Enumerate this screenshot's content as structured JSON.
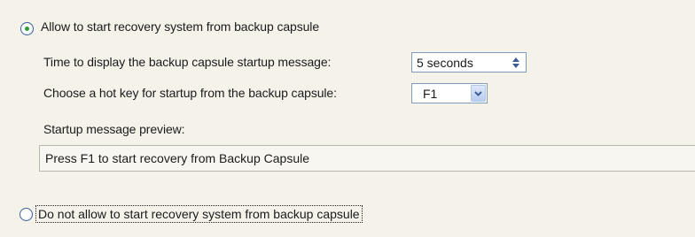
{
  "options": {
    "allow": {
      "label": "Allow to start recovery system from backup capsule",
      "selected": true
    },
    "deny": {
      "label": "Do not allow to start recovery system from backup capsule",
      "selected": false
    }
  },
  "settings": {
    "display_time_label": "Time to display the  backup capsule startup message:",
    "display_time_value": "5 seconds",
    "hotkey_label": "Choose a hot key for startup from the backup capsule:",
    "hotkey_value": "F1",
    "preview_label": "Startup message preview:",
    "preview_text": "Press F1 to start recovery from Backup Capsule"
  },
  "colors": {
    "background": "#f4f2e9",
    "radio_dot": "#2a9e3a",
    "field_border": "#7f9db9"
  },
  "icons": {
    "spinner": "up-down-arrows-icon",
    "dropdown": "chevron-down-icon"
  }
}
